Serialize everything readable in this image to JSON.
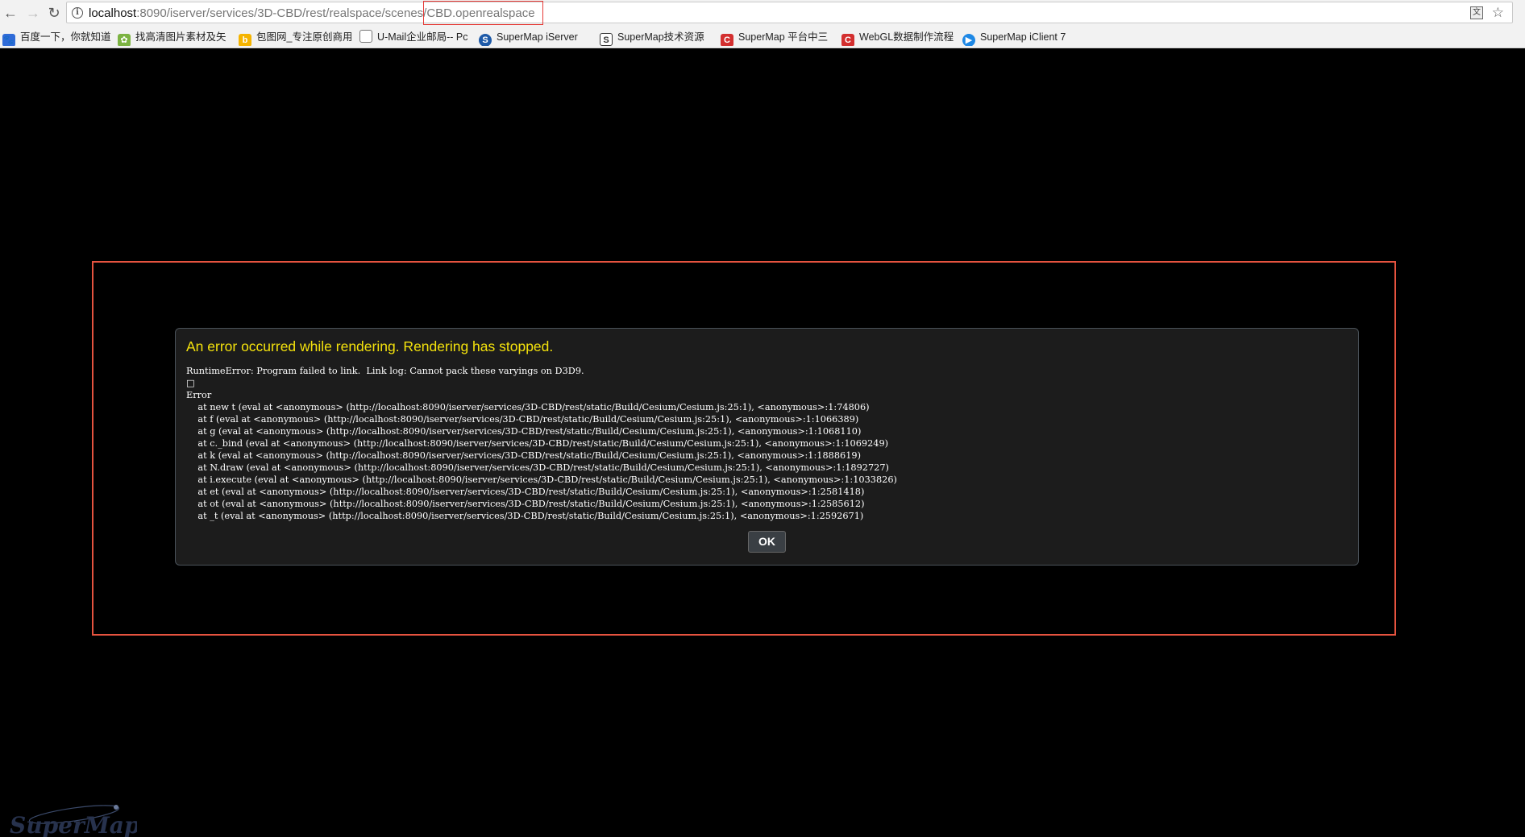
{
  "browser": {
    "url_host": "localhost",
    "url_rest": ":8090/iserver/services/3D-CBD/rest/realspace/scenes/CBD.openrealspace",
    "bookmarks": [
      {
        "label": "百度一下，你就知道",
        "icon": "paw-icon",
        "color": "#2f6bd8"
      },
      {
        "label": "找高清图片素材及矢",
        "icon": "leaf-icon",
        "color": "#7cb342"
      },
      {
        "label": "包图网_专注原创商用",
        "icon": "b-logo-icon",
        "color": "#f5b400"
      },
      {
        "label": "U-Mail企业邮局-- Pc",
        "icon": "page-icon",
        "color": "#777777"
      },
      {
        "label": "SuperMap iServer",
        "icon": "supermap-icon",
        "color": "#1e5aa8"
      },
      {
        "label": "SuperMap技术资源",
        "icon": "s-logo-icon",
        "color": "#333333"
      },
      {
        "label": "SuperMap 平台中三",
        "icon": "c-logo-icon",
        "color": "#d32f2f"
      },
      {
        "label": "WebGL数据制作流程",
        "icon": "c-logo-icon",
        "color": "#d32f2f"
      },
      {
        "label": "SuperMap iClient 7",
        "icon": "iclient-icon",
        "color": "#1e88e5"
      }
    ]
  },
  "error": {
    "title": "An error occurred while rendering. Rendering has stopped.",
    "message": "RuntimeError: Program failed to link.  Link log: Cannot pack these varyings on D3D9.\n□\nError\n    at new t (eval at <anonymous> (http://localhost:8090/iserver/services/3D-CBD/rest/static/Build/Cesium/Cesium.js:25:1), <anonymous>:1:74806)\n    at f (eval at <anonymous> (http://localhost:8090/iserver/services/3D-CBD/rest/static/Build/Cesium/Cesium.js:25:1), <anonymous>:1:1066389)\n    at g (eval at <anonymous> (http://localhost:8090/iserver/services/3D-CBD/rest/static/Build/Cesium/Cesium.js:25:1), <anonymous>:1:1068110)\n    at c._bind (eval at <anonymous> (http://localhost:8090/iserver/services/3D-CBD/rest/static/Build/Cesium/Cesium.js:25:1), <anonymous>:1:1069249)\n    at k (eval at <anonymous> (http://localhost:8090/iserver/services/3D-CBD/rest/static/Build/Cesium/Cesium.js:25:1), <anonymous>:1:1888619)\n    at N.draw (eval at <anonymous> (http://localhost:8090/iserver/services/3D-CBD/rest/static/Build/Cesium/Cesium.js:25:1), <anonymous>:1:1892727)\n    at i.execute (eval at <anonymous> (http://localhost:8090/iserver/services/3D-CBD/rest/static/Build/Cesium/Cesium.js:25:1), <anonymous>:1:1033826)\n    at et (eval at <anonymous> (http://localhost:8090/iserver/services/3D-CBD/rest/static/Build/Cesium/Cesium.js:25:1), <anonymous>:1:2581418)\n    at ot (eval at <anonymous> (http://localhost:8090/iserver/services/3D-CBD/rest/static/Build/Cesium/Cesium.js:25:1), <anonymous>:1:2585612)\n    at _t (eval at <anonymous> (http://localhost:8090/iserver/services/3D-CBD/rest/static/Build/Cesium/Cesium.js:25:1), <anonymous>:1:2592671)",
    "ok_label": "OK"
  },
  "logo": {
    "text": "SuperMap"
  },
  "colors": {
    "title_yellow": "#f4e20c",
    "annotation_red": "#e5533f"
  }
}
